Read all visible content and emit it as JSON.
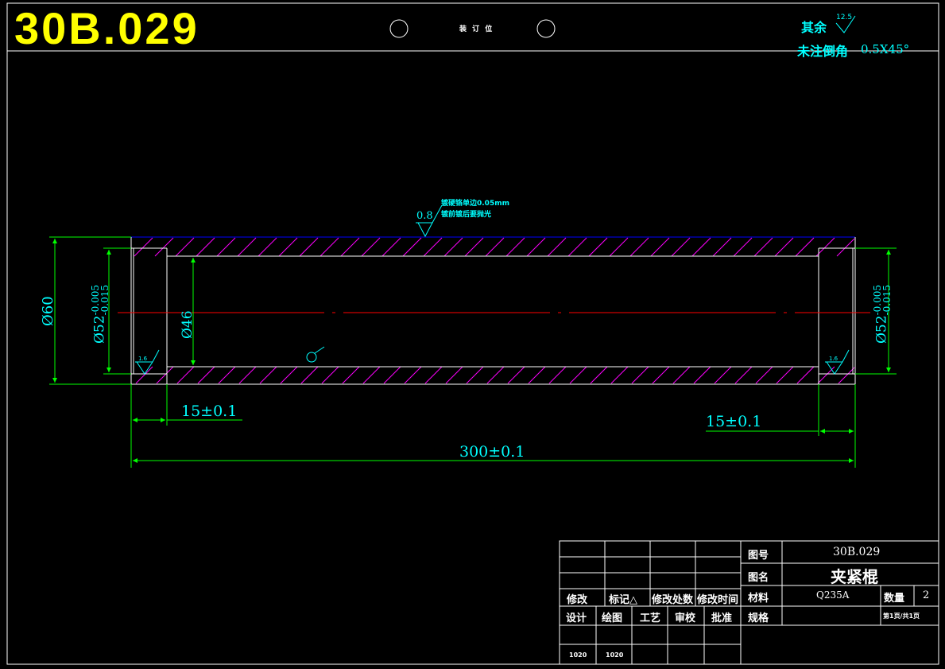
{
  "drawing_number": "30B.029",
  "binding_label": "装 订 位",
  "notes": {
    "rest_label": "其余",
    "rest_roughness": "12.5",
    "chamfer_label": "未注倒角",
    "chamfer_value": "0.5X45°"
  },
  "surface_note": {
    "line1": "镀硬铬单边0.05mm",
    "line2": "镀前镀后要抛光",
    "roughness": "0.8"
  },
  "dimensions": {
    "left_end": "15±0.1",
    "right_end": "15±0.1",
    "total_length": "300±0.1",
    "outer_diameter": "Ø60",
    "inner_diameter": "Ø46",
    "bore_left": "Ø52",
    "bore_right": "Ø52",
    "bore_tol_upper": "-0.005",
    "bore_tol_lower": "-0.015",
    "bore_roughness": "1.6"
  },
  "title_block": {
    "drawing_no_label": "图号",
    "drawing_no_value": "30B.029",
    "name_label": "图名",
    "name_value": "夹紧棍",
    "material_label": "材料",
    "material_value": "Q235A",
    "quantity_label": "数量",
    "quantity_value": "2",
    "spec_label": "规格",
    "page_info": "第1页/共1页",
    "revision_headers": [
      "修改",
      "标记△",
      "修改处数",
      "修改时间"
    ],
    "sign_headers": [
      "设计",
      "绘图",
      "工艺",
      "审校",
      "批准"
    ],
    "sign_values": [
      "1020",
      "1020",
      "",
      "",
      ""
    ]
  },
  "colors": {
    "background": "#000000",
    "outline": "#ffffff",
    "dimension": "#00ff00",
    "dimension_text": "#00ffff",
    "hatch": "#ff00ff",
    "centerline": "#ff0000",
    "title_code": "#ffff00",
    "top_edge": "#0000ff"
  }
}
